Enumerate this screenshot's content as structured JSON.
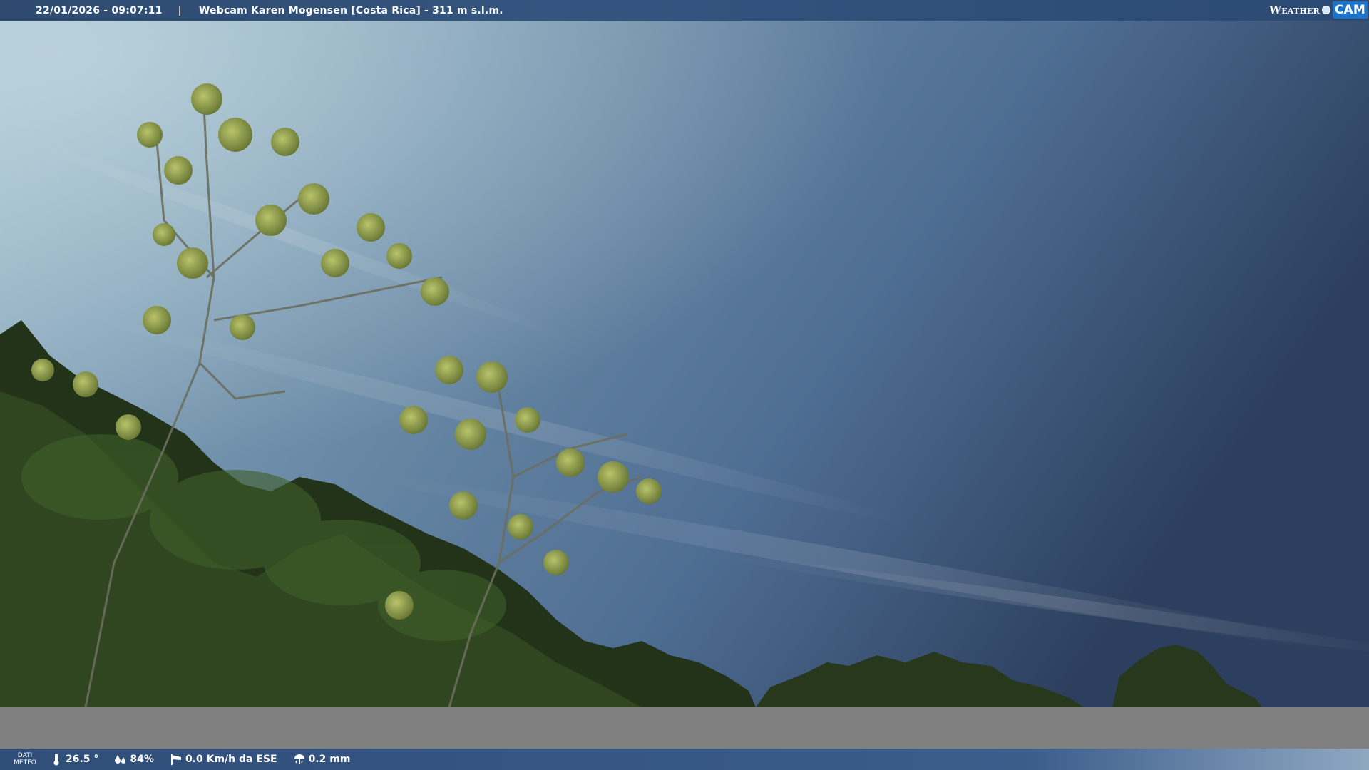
{
  "header": {
    "datetime": "22/01/2026 - 09:07:11",
    "separator": "|",
    "title": "Webcam Karen Mogensen [Costa Rica]  - 311 m s.l.m.",
    "logo_left": "Weather",
    "logo_right": "CAM"
  },
  "footer": {
    "dati_line1": "DATI",
    "dati_line2": "METEO",
    "temperature": "26.5 °",
    "humidity": "84%",
    "wind": "0.0 Km/h da ESE",
    "rain": "0.2 mm"
  },
  "icons": {
    "temperature": "thermometer-icon",
    "humidity": "droplets-icon",
    "wind": "windsock-icon",
    "rain": "rain-gauge-icon"
  },
  "colors": {
    "sky_light": "#a9c3d0",
    "sky_dark": "#2c3f5e",
    "foliage_dark": "#1e2d14",
    "foliage_light": "#a5b255",
    "bar_blue": "#2f4e78",
    "logo_blue": "#1c74c9",
    "gray_band": "#808080"
  }
}
